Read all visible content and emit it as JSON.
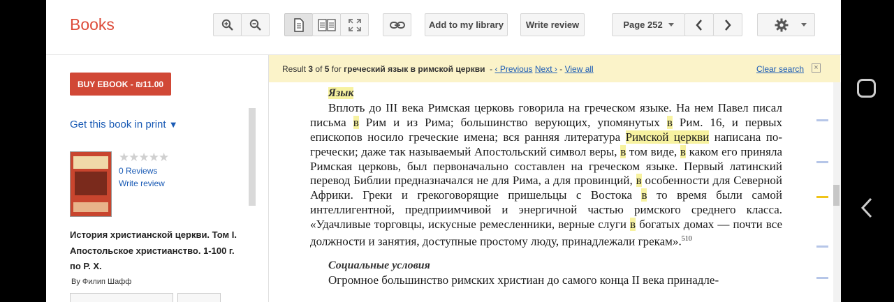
{
  "app": {
    "brand": "Books"
  },
  "toolbar": {
    "add_library_label": "Add to my library",
    "write_review_label": "Write review",
    "page_label": "Page 252"
  },
  "sidebar": {
    "buy_label": "BUY EBOOK - ₪11.00",
    "get_print_label": "Get this book in print",
    "get_print_caret": "▼",
    "stars": "★★★★★",
    "rating": 0,
    "reviews_label": "0 Reviews",
    "write_review_label": "Write review",
    "book_title": "История христианской церкви. Том I. Апостольское христианство. 1-100 г. по Р. Х.",
    "author_prefix": "By",
    "author_name": "Филип Шафф"
  },
  "search": {
    "prefix": "Result",
    "current": "3",
    "of": "of",
    "total": "5",
    "for": "for",
    "query": "греческий язык в римской церкви",
    "sep": "-",
    "previous_label": "‹ Previous",
    "next_label": "Next ›",
    "view_all_label": "View all",
    "clear_label": "Clear search",
    "close_glyph": "×"
  },
  "page_content": {
    "heading1": "Язык",
    "para": [
      {
        "t": "Вплоть до III века Римская церковь говорила на греческом языке. На нем Павел писал письма "
      },
      {
        "h": "в"
      },
      {
        "t": " Рим и из Рима; большинство верующих, упомянутых "
      },
      {
        "h": "в"
      },
      {
        "t": " Рим. 16, и первых епископов носило греческие имена; вся ранняя литература "
      },
      {
        "h": "Римской церкви"
      },
      {
        "t": " написана по-гречески; даже так называемый Апостольский символ веры, "
      },
      {
        "h": "в"
      },
      {
        "t": " том виде, "
      },
      {
        "h": "в"
      },
      {
        "t": " каком его приняла Римская церковь, был первоначально составлен на греческом языке. Первый латинский перевод Библии предназначался не для Рима, а для провинций, "
      },
      {
        "h": "в"
      },
      {
        "t": " особенности для Северной Африки. Греки и грекоговорящие пришельцы с Востока "
      },
      {
        "h": "в"
      },
      {
        "t": " то время были самой интеллигентной, предприимчивой и энергичной частью римского среднего класса. «Удачливые торговцы, искусные ремесленники, верные слуги "
      },
      {
        "h": "в"
      },
      {
        "t": " богатых домах — почти все должности и занятия, доступные простому люду, принадлежали грекам»."
      }
    ],
    "footnote": "510",
    "heading2": "Социальные условия",
    "para2": "Огромное большинство римских христиан до самого конца II века принадле-"
  }
}
